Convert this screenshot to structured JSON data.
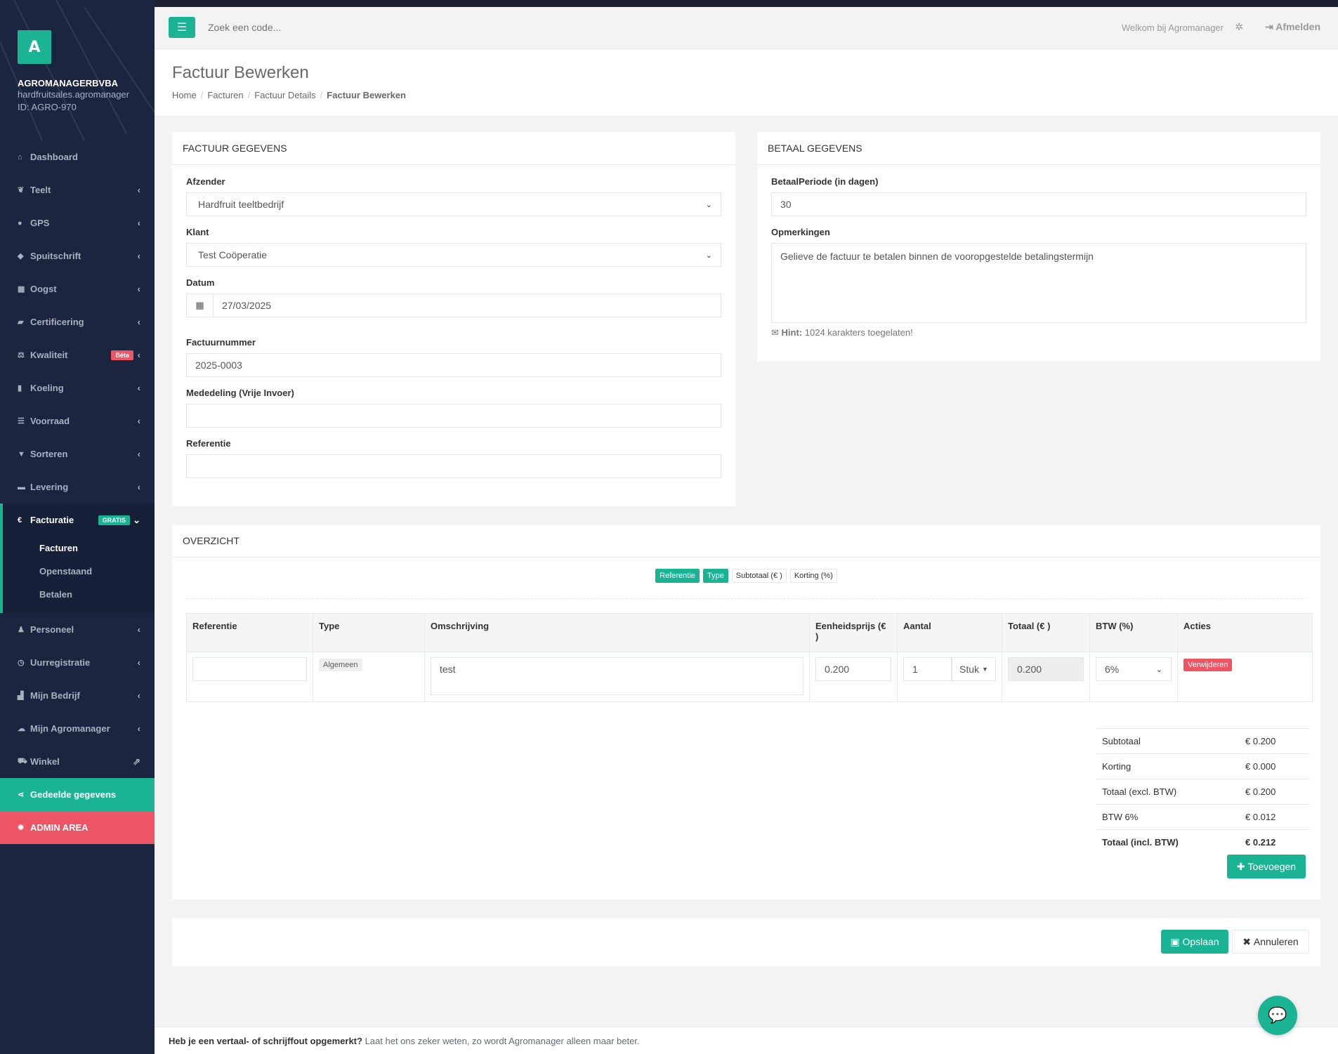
{
  "sidebar": {
    "logo_letter": "A",
    "company": "AGROMANAGERBVBA",
    "domain": "hardfruitsales.agromanager",
    "account_id": "ID: AGRO-970",
    "items": [
      {
        "label": "Dashboard",
        "icon": "home-icon"
      },
      {
        "label": "Teelt",
        "icon": "leaf-icon"
      },
      {
        "label": "GPS",
        "icon": "map-marker-icon"
      },
      {
        "label": "Spuitschrift",
        "icon": "tint-icon"
      },
      {
        "label": "Oogst",
        "icon": "basket-icon"
      },
      {
        "label": "Certificering",
        "icon": "book-icon"
      },
      {
        "label": "Kwaliteit",
        "icon": "balance-scale-icon",
        "badge": "Bèta"
      },
      {
        "label": "Koeling",
        "icon": "thermometer-icon"
      },
      {
        "label": "Voorraad",
        "icon": "list-icon"
      },
      {
        "label": "Sorteren",
        "icon": "filter-icon"
      },
      {
        "label": "Levering",
        "icon": "truck-icon"
      }
    ],
    "facturatie": {
      "label": "Facturatie",
      "badge": "GRATIS",
      "sub": [
        "Facturen",
        "Openstaand",
        "Betalen"
      ]
    },
    "items2": [
      {
        "label": "Personeel",
        "icon": "user-icon"
      },
      {
        "label": "Uurregistratie",
        "icon": "clock-icon"
      },
      {
        "label": "Mijn Bedrijf",
        "icon": "industry-icon"
      },
      {
        "label": "Mijn Agromanager",
        "icon": "cloud-icon"
      },
      {
        "label": "Winkel",
        "icon": "cart-icon"
      }
    ],
    "shared": "Gedeelde gegevens",
    "admin": "ADMIN AREA"
  },
  "topbar": {
    "search_placeholder": "Zoek een code...",
    "welcome": "Welkom bij Agromanager",
    "logout": "Afmelden"
  },
  "page": {
    "title": "Factuur Bewerken",
    "breadcrumbs": [
      "Home",
      "Facturen",
      "Factuur Details",
      "Factuur Bewerken"
    ]
  },
  "invoice": {
    "title": "FACTUUR GEGEVENS",
    "sender_label": "Afzender",
    "sender_value": "Hardfruit teeltbedrijf",
    "client_label": "Klant",
    "client_value": "Test Coöperatie",
    "date_label": "Datum",
    "date_value": "27/03/2025",
    "number_label": "Factuurnummer",
    "number_value": "2025-0003",
    "message_label": "Mededeling (Vrije Invoer)",
    "message_value": "",
    "reference_label": "Referentie",
    "reference_value": ""
  },
  "payment": {
    "title": "BETAAL GEGEVENS",
    "period_label": "BetaalPeriode (in dagen)",
    "period_value": "30",
    "remarks_label": "Opmerkingen",
    "remarks_value": "Gelieve de factuur te betalen binnen de vooropgestelde betalingstermijn",
    "hint_bold": "Hint:",
    "hint_text": "1024 karakters toegelaten!"
  },
  "overview": {
    "title": "OVERZICHT",
    "toggles": [
      "Referentie",
      "Type",
      "Subtotaal (€ )",
      "Korting (%)"
    ],
    "columns": [
      "Referentie",
      "Type",
      "Omschrijving",
      "Eenheidsprijs (€ )",
      "Aantal",
      "Totaal (€ )",
      "BTW (%)",
      "Acties"
    ],
    "row": {
      "reference": "",
      "type": "Algemeen",
      "description": "test",
      "unit_price": "0.200",
      "quantity": "1",
      "unit": "Stuk",
      "total": "0.200",
      "vat": "6%",
      "delete": "Verwijderen"
    },
    "totals": [
      {
        "label": "Subtotaal",
        "value": "€ 0.200"
      },
      {
        "label": "Korting",
        "value": "€ 0.000"
      },
      {
        "label": "Totaal (excl. BTW)",
        "value": "€ 0.200"
      },
      {
        "label": "BTW 6%",
        "value": "€ 0.012"
      },
      {
        "label": "Totaal (incl. BTW)",
        "value": "€ 0.212"
      }
    ],
    "add_button": "Toevoegen"
  },
  "actions": {
    "save": "Opslaan",
    "cancel": "Annuleren"
  },
  "footer": {
    "bold": "Heb je een vertaal- of schrijffout opgemerkt?",
    "text": "Laat het ons zeker weten, zo wordt Agromanager alleen maar beter."
  }
}
